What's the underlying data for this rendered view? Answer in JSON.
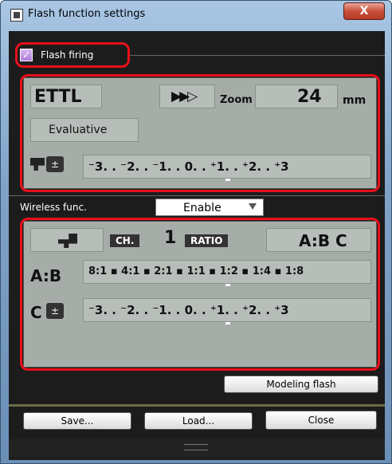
{
  "window": {
    "title": "Flash function settings",
    "close_glyph": "X"
  },
  "flash_firing": {
    "label": "Flash firing",
    "checked": true
  },
  "flash_panel": {
    "mode": "ETTL",
    "hs_sync_glyph": "▶▶▷",
    "zoom_label": "Zoom",
    "zoom_value": "24",
    "zoom_unit": "mm",
    "metering": "Evaluative",
    "fec_scale": "⁻3. . ⁻2. . ⁻1. . 0. . ⁺1. . ⁺2. . ⁺3",
    "fec_level": 0
  },
  "wireless": {
    "label": "Wireless func.",
    "value": "Enable",
    "channel_label": "CH.",
    "channel": "1",
    "ratio_label": "RATIO",
    "ratio_mode": "A:B C",
    "ab_label": "A:B",
    "ratio_scale": "8:1 ▪ 4:1 ▪ 2:1 ▪ 1:1 ▪ 1:2 ▪ 1:4 ▪ 1:8",
    "ratio_value": "1:1",
    "c_label": "C",
    "c_scale": "⁻3. . ⁻2. . ⁻1. . 0. . ⁺1. . ⁺2. . ⁺3",
    "c_level": 0
  },
  "buttons": {
    "modeling": "Modeling flash",
    "save": "Save...",
    "load": "Load...",
    "close": "Close"
  },
  "icons": [
    "flash-head-icon",
    "flash-exposure-comp-icon",
    "high-speed-sync-icon",
    "wireless-flash-icon",
    "dropdown-arrow-icon"
  ],
  "colors": {
    "lcd": "#a6ada8",
    "highlight": "#e8101a",
    "background": "#1c1c1c"
  }
}
